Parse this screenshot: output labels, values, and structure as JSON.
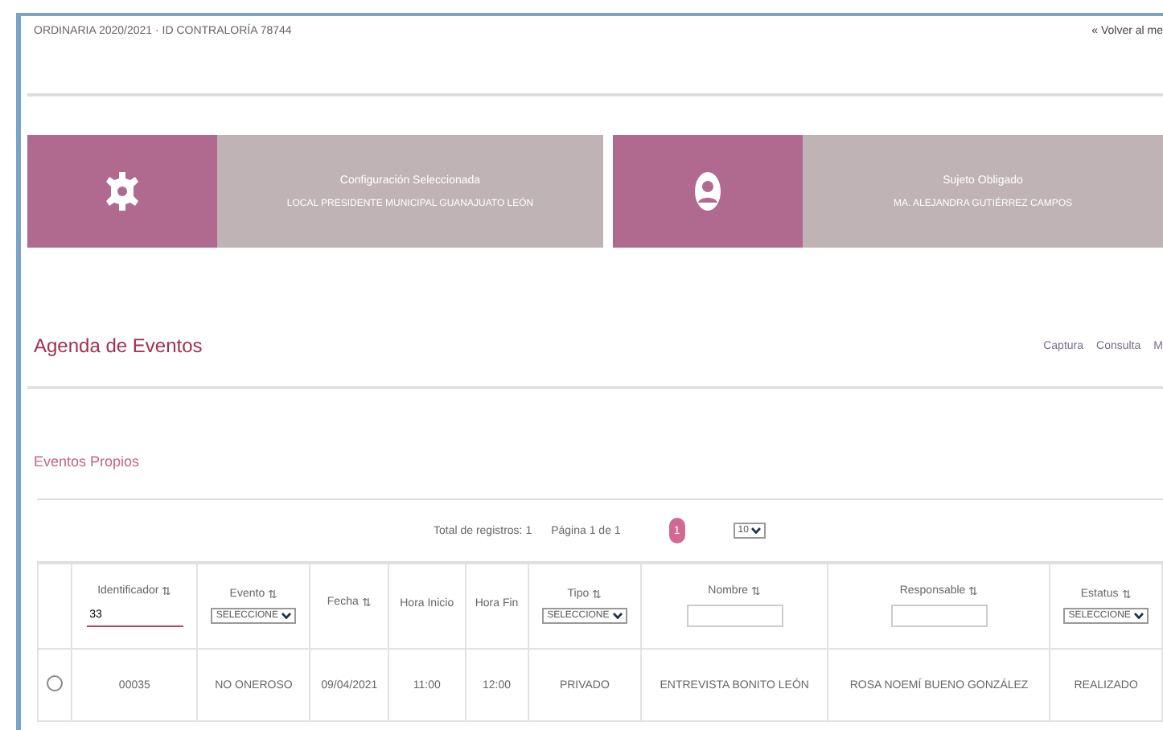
{
  "header": {
    "breadcrumb": "ORDINARIA 2020/2021 · ID CONTRALORÍA 78744",
    "back_link": "« Volver al me"
  },
  "cards": [
    {
      "kind": "gear",
      "title": "Configuración Seleccionada",
      "subtitle": "LOCAL PRESIDENTE MUNICIPAL GUANAJUATO LEÓN"
    },
    {
      "kind": "user",
      "title": "Sujeto Obligado",
      "subtitle": "MA. ALEJANDRA GUTIÉRREZ CAMPOS"
    }
  ],
  "section": {
    "title": "Agenda de Eventos",
    "links": [
      "Captura",
      "Consulta",
      "M"
    ]
  },
  "subsection": "Eventos Propios",
  "pager": {
    "total": "Total de registros: 1",
    "page": "Página 1 de 1",
    "current": "1",
    "page_size": "10"
  },
  "table": {
    "columns": [
      {
        "kind": "input",
        "label": "Identificador",
        "sort": "⇅",
        "value": "33"
      },
      {
        "kind": "select",
        "label": "Evento",
        "sort": "⇅",
        "value": "SELECCIONE"
      },
      {
        "kind": "plain",
        "label": "Fecha",
        "sort": "⇅"
      },
      {
        "kind": "plain",
        "label": "Hora Inicio"
      },
      {
        "kind": "plain",
        "label": "Hora Fin"
      },
      {
        "kind": "select",
        "label": "Tipo",
        "sort": "⇅",
        "value": "SELECCIONE"
      },
      {
        "kind": "input",
        "label": "Nombre",
        "sort": "⇅"
      },
      {
        "kind": "input",
        "label": "Responsable",
        "sort": "⇅"
      },
      {
        "kind": "select",
        "label": "Estatus",
        "sort": "⇅",
        "value": "SELECCIONE"
      }
    ],
    "rows": [
      {
        "selected": false,
        "cells": [
          "00035",
          "NO ONEROSO",
          "09/04/2021",
          "11:00",
          "12:00",
          "PRIVADO",
          "ENTREVISTA BONITO LEÓN",
          "ROSA NOEMÍ BUENO GONZÁLEZ",
          "REALIZADO"
        ]
      }
    ]
  }
}
